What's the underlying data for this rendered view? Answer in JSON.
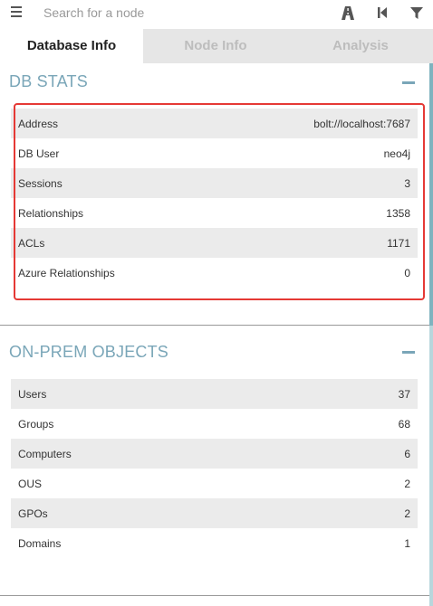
{
  "search": {
    "placeholder": "Search for a node"
  },
  "tabs": [
    {
      "label": "Database Info"
    },
    {
      "label": "Node Info"
    },
    {
      "label": "Analysis"
    }
  ],
  "db_stats": {
    "title": "DB STATS",
    "rows": [
      {
        "label": "Address",
        "value": "bolt://localhost:7687"
      },
      {
        "label": "DB User",
        "value": "neo4j"
      },
      {
        "label": "Sessions",
        "value": "3"
      },
      {
        "label": "Relationships",
        "value": "1358"
      },
      {
        "label": "ACLs",
        "value": "1171"
      },
      {
        "label": "Azure Relationships",
        "value": "0"
      }
    ]
  },
  "onprem": {
    "title": "ON-PREM OBJECTS",
    "rows": [
      {
        "label": "Users",
        "value": "37"
      },
      {
        "label": "Groups",
        "value": "68"
      },
      {
        "label": "Computers",
        "value": "6"
      },
      {
        "label": "OUS",
        "value": "2"
      },
      {
        "label": "GPOs",
        "value": "2"
      },
      {
        "label": "Domains",
        "value": "1"
      }
    ]
  },
  "colors": {
    "accent": "#7aa6b8",
    "highlight": "#e53935",
    "row_shade": "#ebebeb"
  },
  "icons": [
    "menu-icon",
    "pathfinding-icon",
    "back-icon",
    "filter-icon",
    "collapse-icon"
  ]
}
